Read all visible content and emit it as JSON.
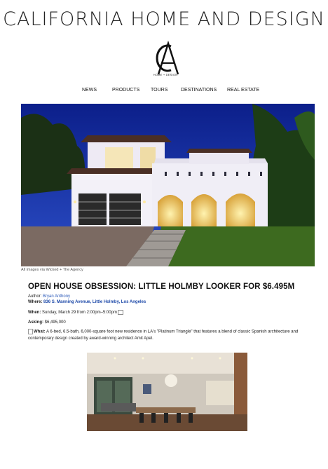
{
  "site": {
    "title": "CALIFORNIA HOME AND DESIGN",
    "logo_text": "HOME + DESIGN"
  },
  "nav": {
    "items": [
      "NEWS",
      "PRODUCTS",
      "TOURS",
      "DESTINATIONS",
      "REAL ESTATE"
    ]
  },
  "hero": {
    "caption": "All images via Wicked + The Agency"
  },
  "article": {
    "headline": "OPEN HOUSE OBSESSION: LITTLE HOLMBY LOOKER FOR $6.495M",
    "author_label": "Author:",
    "author_name": "Bryan Anthony",
    "where_label": "Where:",
    "where_value": "836 S. Manning Avenue, Little Holmby, Los Angeles",
    "when_label": "When:",
    "when_value": "Sunday, March 29 from 2:00pm–5:00pm",
    "asking_label": "Asking:",
    "asking_value": "$6,495,000",
    "what_label": "What:",
    "what_value": "A 6-bed, 6.5-bath, 6,000-square foot new residence in LA's \"Platinum Triangle\" that features a blend of classic Spanish architecture and contemporary design created by award-winning architect Amit Apel."
  },
  "icons": {
    "logo": "ca-monogram-icon",
    "calendar": "calendar-icon",
    "image": "broken-image-icon"
  }
}
